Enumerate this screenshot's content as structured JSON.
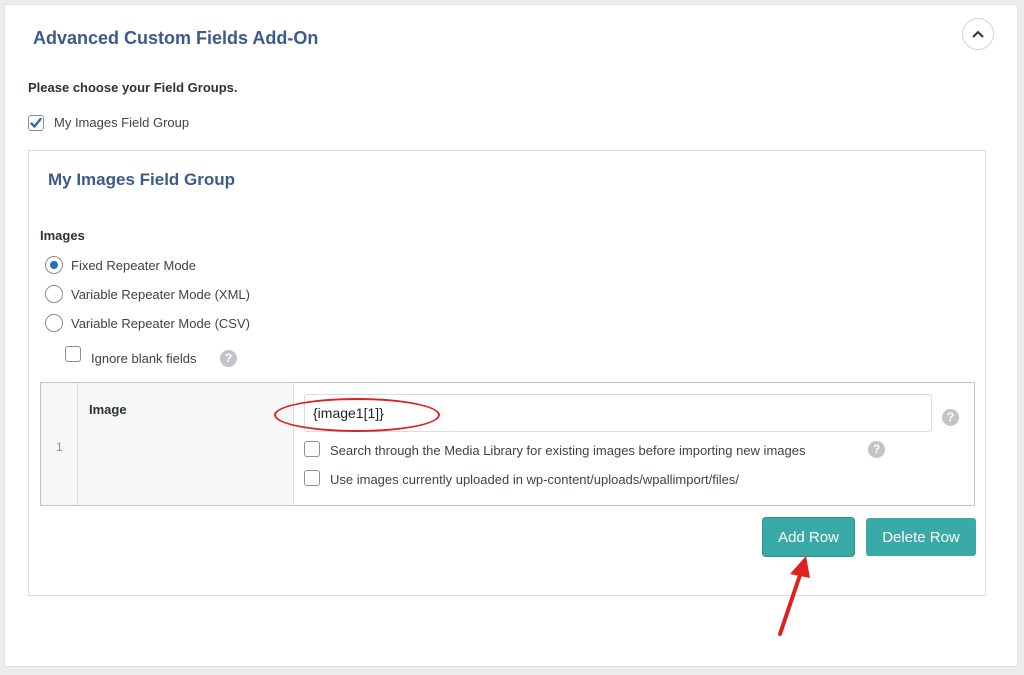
{
  "panel": {
    "title": "Advanced Custom Fields Add-On",
    "instruction": "Please choose your Field Groups."
  },
  "field_groups": [
    {
      "label": "My Images Field Group",
      "checked": true
    }
  ],
  "group": {
    "title": "My Images Field Group",
    "field_label": "Images",
    "modes": [
      {
        "label": "Fixed Repeater Mode",
        "selected": true
      },
      {
        "label": "Variable Repeater Mode (XML)",
        "selected": false
      },
      {
        "label": "Variable Repeater Mode (CSV)",
        "selected": false
      }
    ],
    "ignore_blank_label": "Ignore blank fields",
    "ignore_blank_checked": false
  },
  "repeater": {
    "row_number": "1",
    "sub_field_label": "Image",
    "image_value": "{image1[1]}",
    "search_media_label": "Search through the Media Library for existing images before importing new images",
    "use_uploaded_label": "Use images currently uploaded in wp-content/uploads/wpallimport/files/"
  },
  "buttons": {
    "add_row": "Add Row",
    "delete_row": "Delete Row"
  },
  "help_glyph": "?",
  "colors": {
    "accent_title": "#3d5a8c",
    "button_teal": "#3aaaa8",
    "checkbox_blue": "#2271b1",
    "annotation_red": "#e02020"
  }
}
